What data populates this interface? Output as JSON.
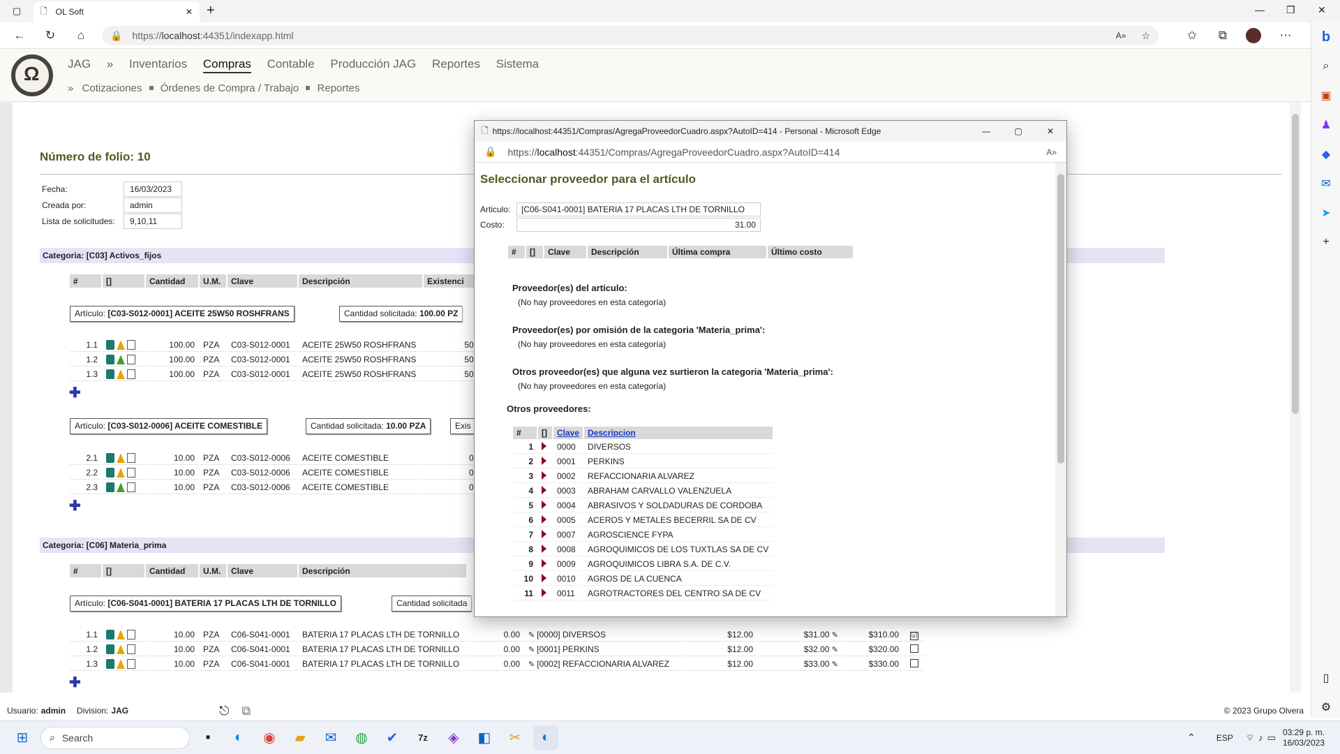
{
  "browser": {
    "tab_title": "OL Soft",
    "url_prefix": "https://",
    "url_host": "localhost",
    "url_rest": ":44351/indexapp.html"
  },
  "app": {
    "company": "JAG",
    "menu": [
      "Inventarios",
      "Compras",
      "Contable",
      "Producción JAG",
      "Reportes",
      "Sistema"
    ],
    "active_menu": "Compras",
    "submenu": [
      "Cotizaciones",
      "Órdenes de Compra / Trabajo",
      "Reportes"
    ]
  },
  "folio": {
    "title": "Número de folio: 10",
    "fields": [
      {
        "label": "Fecha:",
        "value": "16/03/2023"
      },
      {
        "label": "Creada por:",
        "value": "admin"
      },
      {
        "label": "Lista de solicitudes:",
        "value": "9,10,11"
      }
    ]
  },
  "headers_cat1": [
    "#",
    "[]",
    "Cantidad",
    "U.M.",
    "Clave",
    "Descripción",
    "Existenci"
  ],
  "cat1": {
    "title": "Categoria: [C03] Activos_fijos",
    "art1": {
      "prefix": "Artículo: ",
      "name": "[C03-S012-0001] ACEITE 25W50 ROSHFRANS",
      "qty_label": "Cantidad solicitada: ",
      "qty": "100.00 PZ"
    },
    "rows1": [
      {
        "n": "1.1",
        "qty": "100.00",
        "um": "PZA",
        "clave": "C03-S012-0001",
        "desc": "ACEITE 25W50 ROSHFRANS",
        "exist": "50."
      },
      {
        "n": "1.2",
        "qty": "100.00",
        "um": "PZA",
        "clave": "C03-S012-0001",
        "desc": "ACEITE 25W50 ROSHFRANS",
        "exist": "50."
      },
      {
        "n": "1.3",
        "qty": "100.00",
        "um": "PZA",
        "clave": "C03-S012-0001",
        "desc": "ACEITE 25W50 ROSHFRANS",
        "exist": "50."
      }
    ],
    "art2": {
      "prefix": "Artículo: ",
      "name": "[C03-S012-0006] ACEITE COMESTIBLE",
      "qty_label": "Cantidad solicitada: ",
      "qty": "10.00 PZA",
      "extra": "Exis"
    },
    "rows2": [
      {
        "n": "2.1",
        "qty": "10.00",
        "um": "PZA",
        "clave": "C03-S012-0006",
        "desc": "ACEITE COMESTIBLE",
        "exist": "0."
      },
      {
        "n": "2.2",
        "qty": "10.00",
        "um": "PZA",
        "clave": "C03-S012-0006",
        "desc": "ACEITE COMESTIBLE",
        "exist": "0."
      },
      {
        "n": "2.3",
        "qty": "10.00",
        "um": "PZA",
        "clave": "C03-S012-0006",
        "desc": "ACEITE COMESTIBLE",
        "exist": "0."
      }
    ]
  },
  "headers_cat2": [
    "#",
    "[]",
    "Cantidad",
    "U.M.",
    "Clave",
    "Descripción"
  ],
  "cat2": {
    "title": "Categoria: [C06] Materia_prima",
    "art1": {
      "prefix": "Artículo: ",
      "name": "[C06-S041-0001] BATERIA 17 PLACAS LTH DE TORNILLO",
      "qty_label": "Cantidad solicitada"
    },
    "rows1": [
      {
        "n": "1.1",
        "qty": "10.00",
        "um": "PZA",
        "clave": "C06-S041-0001",
        "desc": "BATERIA 17 PLACAS LTH DE TORNILLO",
        "exist": "0.00",
        "prov": "[0000] DIVERSOS",
        "ult": "$12.00",
        "costo": "$31.00",
        "total": "$310.00",
        "checked": "☑"
      },
      {
        "n": "1.2",
        "qty": "10.00",
        "um": "PZA",
        "clave": "C06-S041-0001",
        "desc": "BATERIA 17 PLACAS LTH DE TORNILLO",
        "exist": "0.00",
        "prov": "[0001] PERKINS",
        "ult": "$12.00",
        "costo": "$32.00",
        "total": "$320.00",
        "checked": ""
      },
      {
        "n": "1.3",
        "qty": "10.00",
        "um": "PZA",
        "clave": "C06-S041-0001",
        "desc": "BATERIA 17 PLACAS LTH DE TORNILLO",
        "exist": "0.00",
        "prov": "[0002] REFACCIONARIA ALVAREZ",
        "ult": "$12.00",
        "costo": "$33.00",
        "total": "$330.00",
        "checked": ""
      }
    ]
  },
  "footer": {
    "user_label": "Usuario:",
    "user": "admin",
    "div_label": "Division:",
    "division": "JAG",
    "copyright": "© 2023 Grupo Olvera"
  },
  "popup": {
    "window_title": "https://localhost:44351/Compras/AgregaProveedorCuadro.aspx?AutoID=414 - Personal - Microsoft Edge",
    "addr_prefix": "https://",
    "addr_host": "localhost",
    "addr_rest": ":44351/Compras/AgregaProveedorCuadro.aspx?AutoID=414",
    "heading": "Seleccionar proveedor para el artículo",
    "articulo_label": "Articulo:",
    "articulo": "[C06-S041-0001] BATERIA 17 PLACAS LTH DE TORNILLO",
    "costo_label": "Costo:",
    "costo": "31.00",
    "hist_headers": [
      "#",
      "[]",
      "Clave",
      "Descripción",
      "Última compra",
      "Último costo"
    ],
    "sec1": "Proveedor(es) del artículo:",
    "sec2": "Proveedor(es) por omisión de la categoria 'Materia_prima':",
    "sec3": "Otros proveedor(es) que alguna vez surtieron la categoria 'Materia_prima':",
    "empty": "(No hay proveedores en esta categoría)",
    "sec4": "Otros proveedores:",
    "prov_headers": [
      "#",
      "[]",
      "Clave",
      "Descripcion"
    ],
    "providers": [
      {
        "n": "1",
        "clave": "0000",
        "desc": "DIVERSOS"
      },
      {
        "n": "2",
        "clave": "0001",
        "desc": "PERKINS"
      },
      {
        "n": "3",
        "clave": "0002",
        "desc": "REFACCIONARIA ALVAREZ"
      },
      {
        "n": "4",
        "clave": "0003",
        "desc": "ABRAHAM CARVALLO VALENZUELA"
      },
      {
        "n": "5",
        "clave": "0004",
        "desc": "ABRASIVOS Y SOLDADURAS DE CORDOBA"
      },
      {
        "n": "6",
        "clave": "0005",
        "desc": "ACEROS Y METALES BECERRIL SA DE CV"
      },
      {
        "n": "7",
        "clave": "0007",
        "desc": "AGROSCIENCE FYPA"
      },
      {
        "n": "8",
        "clave": "0008",
        "desc": "AGROQUIMICOS DE LOS TUXTLAS SA DE CV"
      },
      {
        "n": "9",
        "clave": "0009",
        "desc": "AGROQUIMICOS LIBRA S.A. DE C.V."
      },
      {
        "n": "10",
        "clave": "0010",
        "desc": "AGROS DE LA CUENCA"
      },
      {
        "n": "11",
        "clave": "0011",
        "desc": "AGROTRACTORES DEL CENTRO SA DE CV"
      }
    ]
  },
  "taskbar": {
    "search": "Search",
    "lang": "ESP",
    "time": "03:29 p. m.",
    "date": "16/03/2023"
  }
}
